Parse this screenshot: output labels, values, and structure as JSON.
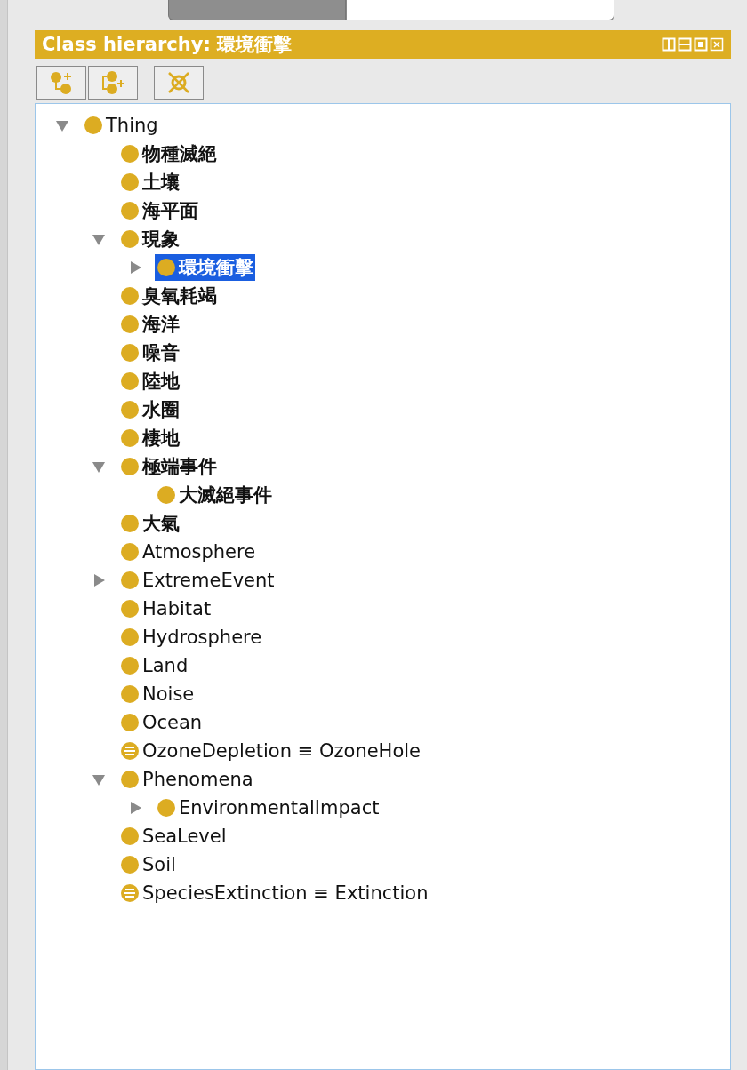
{
  "panel": {
    "title": "Class hierarchy: 環境衝擊"
  },
  "toolbar": [
    {
      "kind": "add-subclass"
    },
    {
      "kind": "add-sibling"
    },
    {
      "kind": "delete"
    }
  ],
  "tree": [
    {
      "label": "Thing",
      "kind": "class",
      "selected": false,
      "expanded": true,
      "children": [
        {
          "label": "物種滅絕",
          "kind": "class",
          "selected": false
        },
        {
          "label": "土壤",
          "kind": "class",
          "selected": false
        },
        {
          "label": "海平面",
          "kind": "class",
          "selected": false
        },
        {
          "label": "現象",
          "kind": "class",
          "selected": false,
          "expanded": true,
          "children": [
            {
              "label": "環境衝擊",
              "kind": "class",
              "selected": true,
              "expanded": false
            }
          ]
        },
        {
          "label": "臭氧耗竭",
          "kind": "class",
          "selected": false
        },
        {
          "label": "海洋",
          "kind": "class",
          "selected": false
        },
        {
          "label": "噪音",
          "kind": "class",
          "selected": false
        },
        {
          "label": "陸地",
          "kind": "class",
          "selected": false
        },
        {
          "label": "水圈",
          "kind": "class",
          "selected": false
        },
        {
          "label": "棲地",
          "kind": "class",
          "selected": false
        },
        {
          "label": "極端事件",
          "kind": "class",
          "selected": false,
          "expanded": true,
          "children": [
            {
              "label": "大滅絕事件",
              "kind": "class",
              "selected": false
            }
          ]
        },
        {
          "label": "大氣",
          "kind": "class",
          "selected": false
        },
        {
          "label": "Atmosphere",
          "kind": "class",
          "selected": false
        },
        {
          "label": "ExtremeEvent",
          "kind": "class",
          "selected": false,
          "expanded": false
        },
        {
          "label": "Habitat",
          "kind": "class",
          "selected": false
        },
        {
          "label": "Hydrosphere",
          "kind": "class",
          "selected": false
        },
        {
          "label": "Land",
          "kind": "class",
          "selected": false
        },
        {
          "label": "Noise",
          "kind": "class",
          "selected": false
        },
        {
          "label": "Ocean",
          "kind": "class",
          "selected": false
        },
        {
          "label": "OzoneDepletion ≡ OzoneHole",
          "kind": "defined",
          "selected": false
        },
        {
          "label": "Phenomena",
          "kind": "class",
          "selected": false,
          "expanded": true,
          "children": [
            {
              "label": "EnvironmentalImpact",
              "kind": "class",
              "selected": false,
              "expanded": false
            }
          ]
        },
        {
          "label": "SeaLevel",
          "kind": "class",
          "selected": false
        },
        {
          "label": "Soil",
          "kind": "class",
          "selected": false
        },
        {
          "label": "SpeciesExtinction ≡ Extinction",
          "kind": "defined",
          "selected": false
        }
      ]
    }
  ]
}
